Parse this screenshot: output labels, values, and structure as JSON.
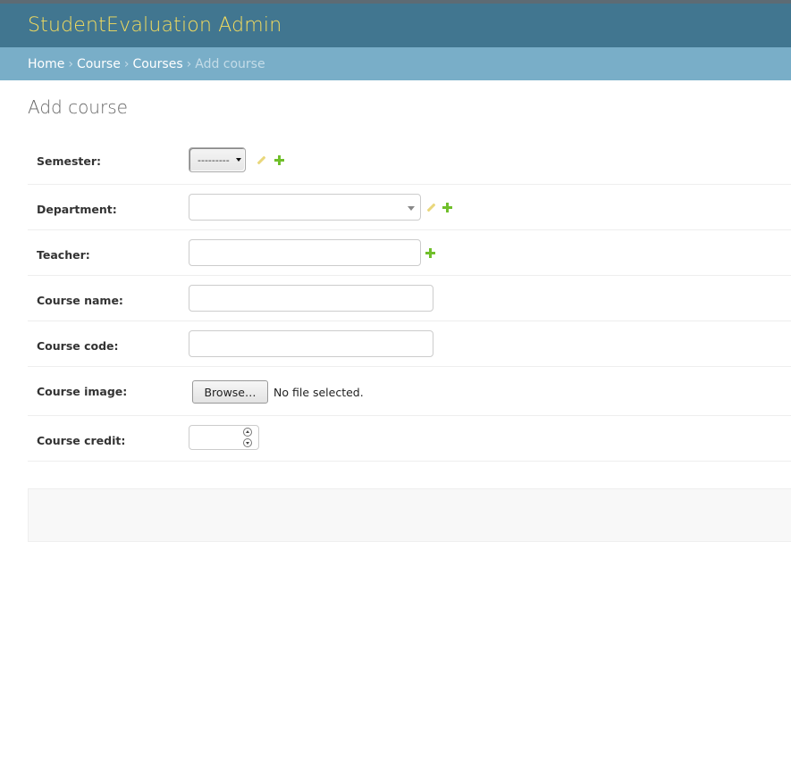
{
  "header": {
    "brand": "StudentEvaluation Admin"
  },
  "breadcrumbs": {
    "home": "Home",
    "course_app": "Course",
    "courses": "Courses",
    "current": "Add course",
    "separator": "›"
  },
  "page": {
    "title": "Add course"
  },
  "form": {
    "semester": {
      "label": "Semester:",
      "value": "---------"
    },
    "department": {
      "label": "Department:",
      "value": ""
    },
    "teacher": {
      "label": "Teacher:",
      "value": ""
    },
    "course_name": {
      "label": "Course name:",
      "value": ""
    },
    "course_code": {
      "label": "Course code:",
      "value": ""
    },
    "course_image": {
      "label": "Course image:",
      "browse_label": "Browse…",
      "status": "No file selected."
    },
    "course_credit": {
      "label": "Course credit:",
      "value": ""
    }
  },
  "colors": {
    "header_bg": "#417690",
    "brand_text": "#f5dd5d",
    "breadcrumb_bg": "#79aec8",
    "add_icon": "#70bf2b",
    "change_icon": "#e9d77b"
  },
  "icons": {
    "change": "pencil-icon",
    "add": "plus-icon"
  }
}
